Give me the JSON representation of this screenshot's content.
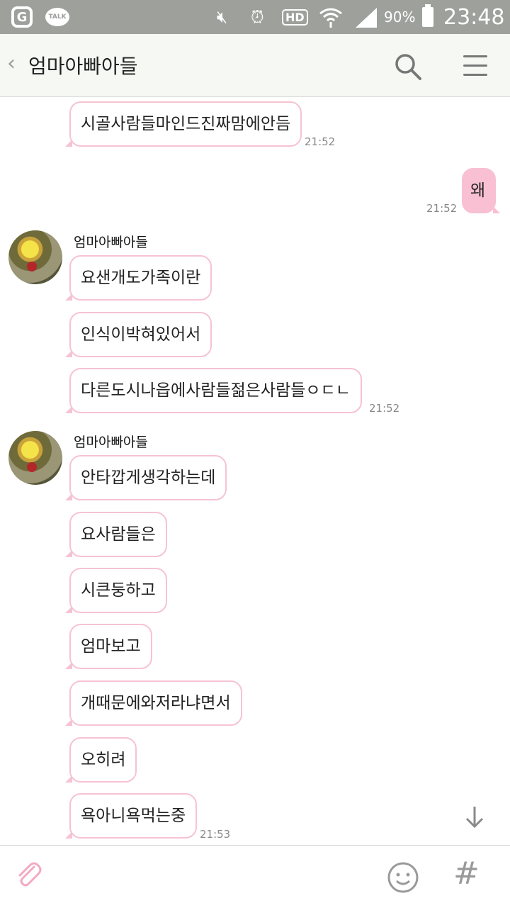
{
  "status_bar": {
    "talk_label": "TALK",
    "battery": "90%",
    "time": "23:48",
    "hd_label": "HD"
  },
  "header": {
    "title": "엄마아빠아들"
  },
  "messages": [
    {
      "text": "시골사람들마인드진짜맘에안듬",
      "time": "21:52"
    },
    {
      "text": "왜",
      "time": "21:52"
    },
    {
      "sender": "엄마아빠아들",
      "text": "요샌개도가족이란"
    },
    {
      "text": "인식이박혀있어서"
    },
    {
      "text": "다른도시나읍에사람들젊은사람들ㅇㄷㄴ",
      "time": "21:52"
    },
    {
      "sender": "엄마아빠아들",
      "text": "안타깝게생각하는데"
    },
    {
      "text": "요사람들은"
    },
    {
      "text": "시큰둥하고"
    },
    {
      "text": "엄마보고"
    },
    {
      "text": "개때문에와저라냐면서"
    },
    {
      "text": "오히려"
    },
    {
      "text": "욕아니욕먹는중",
      "time": "21:53"
    }
  ],
  "colors": {
    "status_bar": "#9ea09c",
    "header_bg": "#f6f9f3",
    "bubble_border": "#f6c3d3",
    "my_bubble": "#f8c0d2"
  },
  "icons": [
    "back-chevron-icon",
    "search-icon",
    "menu-icon",
    "scroll-down-icon",
    "attach-icon",
    "emoji-icon",
    "hashtag-icon"
  ]
}
